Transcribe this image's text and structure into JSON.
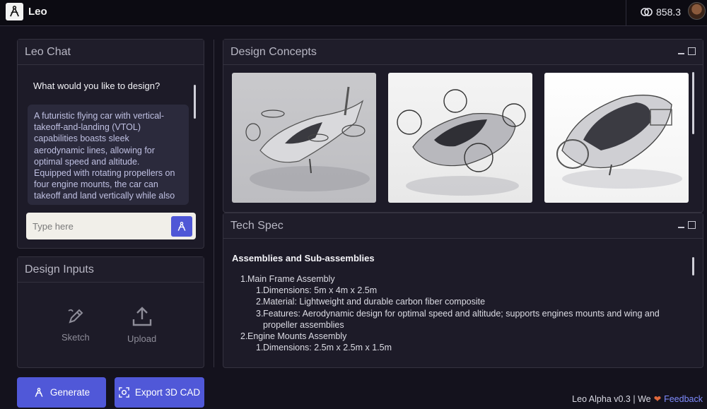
{
  "app": {
    "logo_text": "Leo"
  },
  "account": {
    "credits": "858.3"
  },
  "leo_chat": {
    "title": "Leo Chat",
    "question": "What would you like to design?",
    "reply_lines": [
      "A futuristic flying car with vertical-",
      "takeoff-and-landing (VTOL)",
      "capabilities boasts sleek",
      "aerodynamic lines, allowing for",
      "optimal speed and altitude.",
      "Equipped with rotating propellers on",
      "four engine mounts, the car can",
      "takeoff and land vertically while also"
    ],
    "input_placeholder": "Type here"
  },
  "design_inputs": {
    "title": "Design Inputs",
    "sketch_label": "Sketch",
    "upload_label": "Upload"
  },
  "design_concepts": {
    "title": "Design Concepts"
  },
  "tech_spec": {
    "title": "Tech Spec",
    "heading": "Assemblies and Sub-assemblies",
    "item1": {
      "num": "1.",
      "text": "Main Frame Assembly",
      "sub1": {
        "num": "1.",
        "text": "Dimensions: 5m x 4m x 2.5m"
      },
      "sub2": {
        "num": "2.",
        "text": "Material: Lightweight and durable carbon fiber composite"
      },
      "sub3": {
        "num": "3.",
        "text": "Features: Aerodynamic design for optimal speed and altitude; supports engines mounts and wing and propeller assemblies"
      }
    },
    "item2": {
      "num": "2.",
      "text": "Engine Mounts Assembly",
      "sub1": {
        "num": "1.",
        "text": "Dimensions: 2.5m x 2.5m x 1.5m"
      }
    }
  },
  "actions": {
    "generate_label": "Generate",
    "export_label": "Export 3D CAD"
  },
  "footer": {
    "version_text": "Leo Alpha v0.3 | We",
    "heart": "❤",
    "feedback_label": "Feedback"
  },
  "colors": {
    "accent": "#5058d8",
    "background": "#14121d",
    "panel": "#1d1b28",
    "link": "#7f8cff",
    "heart": "#e0683c"
  }
}
